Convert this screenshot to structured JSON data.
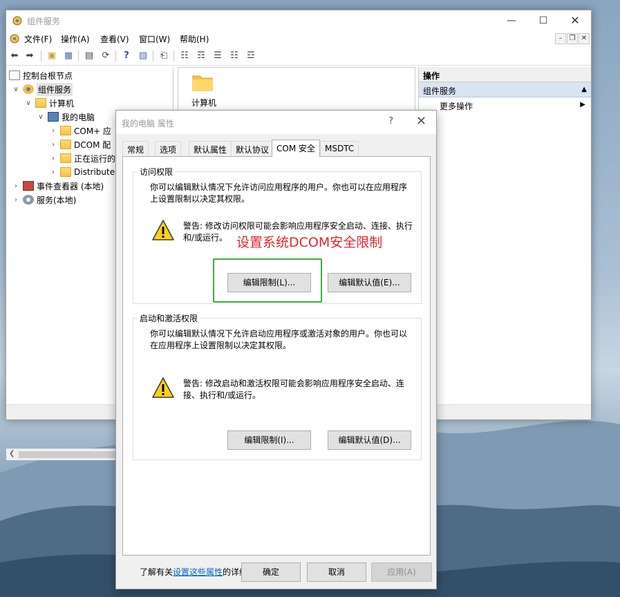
{
  "main_window": {
    "title": "组件服务",
    "menu": [
      "文件(F)",
      "操作(A)",
      "查看(V)",
      "窗口(W)",
      "帮助(H)"
    ],
    "tree": {
      "root": "控制台根节点",
      "component_services": "组件服务",
      "computers": "计算机",
      "my_computer": "我的电脑",
      "com_apps": "COM+ 应",
      "dcom_config": "DCOM 配",
      "running": "正在运行的",
      "distributed": "Distributed",
      "event_viewer": "事件查看器 (本地)",
      "services": "服务(本地)"
    },
    "content": {
      "computer_label": "计算机"
    },
    "actions": {
      "header": "操作",
      "section": "组件服务",
      "more": "更多操作"
    }
  },
  "dialog": {
    "title": "我的电脑 属性",
    "help": "?",
    "tabs": [
      "常规",
      "选项",
      "默认属性",
      "默认协议",
      "COM 安全",
      "MSDTC"
    ],
    "active_tab": "COM 安全",
    "access": {
      "title": "访问权限",
      "description": "你可以编辑默认情况下允许访问应用程序的用户。你也可以在应用程序上设置限制以决定其权限。",
      "warning": "警告: 修改访问权限可能会影响应用程序安全启动、连接、执行和/或运行。",
      "edit_limits": "编辑限制(L)...",
      "edit_default": "编辑默认值(E)..."
    },
    "launch": {
      "title": "启动和激活权限",
      "description": "你可以编辑默认情况下允许启动应用程序或激活对象的用户。你也可以在应用程序上设置限制以决定其权限。",
      "warning": "警告: 修改启动和激活权限可能会影响应用程序安全启动、连接、执行和/或运行。",
      "edit_limits": "编辑限制(I)...",
      "edit_default": "编辑默认值(D)..."
    },
    "info": {
      "prefix": "了解有关",
      "link": "设置这些属性",
      "suffix": "的详细信息。"
    },
    "buttons": {
      "ok": "确定",
      "cancel": "取消",
      "apply": "应用(A)"
    },
    "annotation": "设置系统DCOM安全限制"
  },
  "colors": {
    "annotation": "#e5262b",
    "highlight": "#35b03a",
    "link": "#0066cc",
    "action_section": "#d9e4f1"
  }
}
